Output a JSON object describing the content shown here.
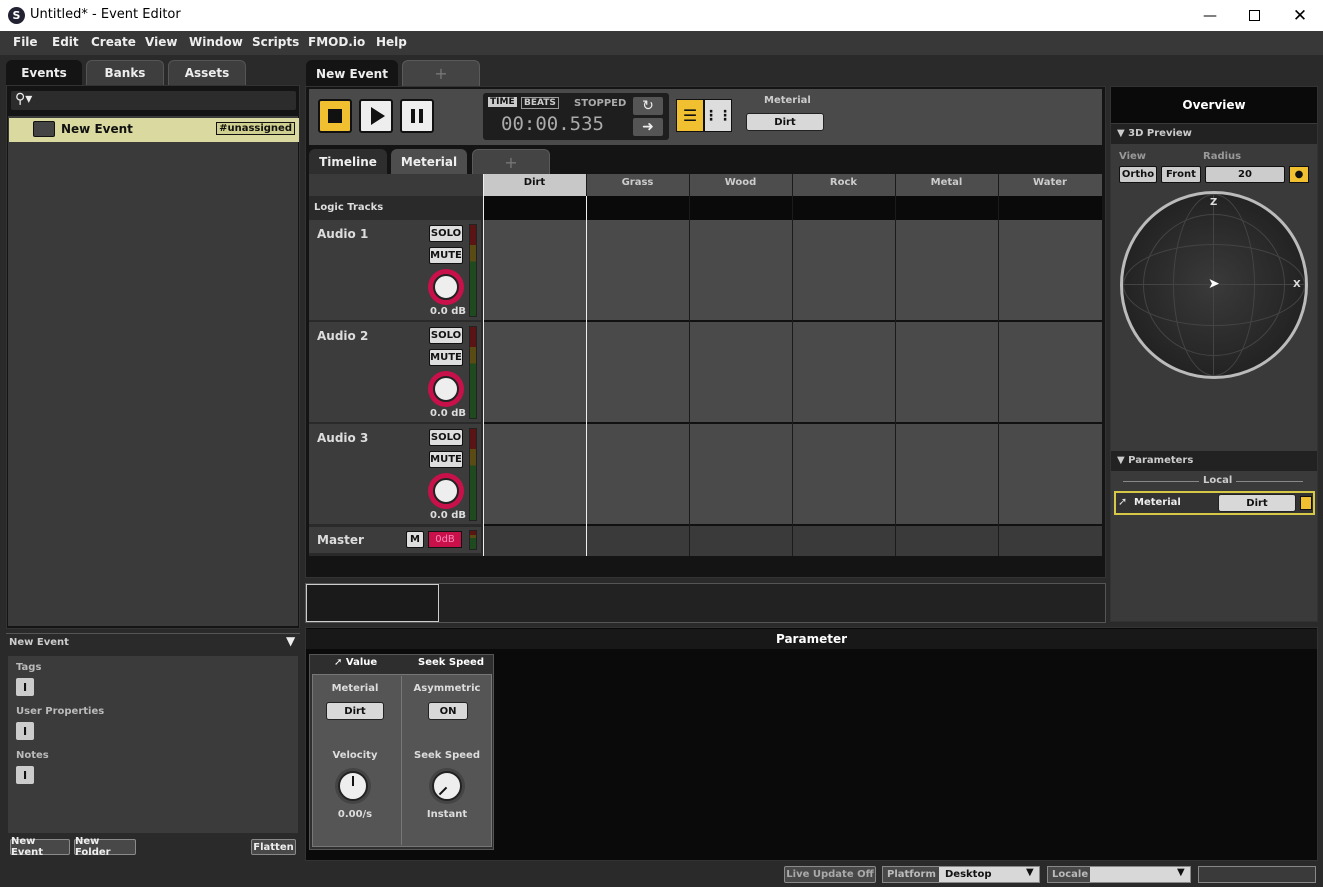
{
  "window": {
    "title": "Untitled* - Event Editor"
  },
  "menu": [
    "File",
    "Edit",
    "Create",
    "View",
    "Window",
    "Scripts",
    "FMOD.io",
    "Help"
  ],
  "browser": {
    "tabs": [
      "Events",
      "Banks",
      "Assets"
    ],
    "item": {
      "label": "New Event",
      "tag": "#unassigned"
    },
    "panel_title": "New Event",
    "sections": [
      "Tags",
      "User Properties",
      "Notes"
    ],
    "buttons": {
      "new_event": "New Event",
      "new_folder": "New Folder",
      "flatten": "Flatten"
    }
  },
  "editor": {
    "event_tab": "New Event",
    "plus": "+",
    "transport": {
      "time": "TIME",
      "beats": "BEATS",
      "status": "STOPPED",
      "clock": "00:00.535"
    },
    "param_label": "Meterial",
    "param_value": "Dirt",
    "subtabs": [
      "Timeline",
      "Meterial"
    ],
    "columns": [
      "Dirt",
      "Grass",
      "Wood",
      "Rock",
      "Metal",
      "Water"
    ],
    "logic_tracks": "Logic Tracks",
    "tracks": [
      {
        "name": "Audio 1",
        "solo": "SOLO",
        "mute": "MUTE",
        "vol": "0.0 dB"
      },
      {
        "name": "Audio 2",
        "solo": "SOLO",
        "mute": "MUTE",
        "vol": "0.0 dB"
      },
      {
        "name": "Audio 3",
        "solo": "SOLO",
        "mute": "MUTE",
        "vol": "0.0 dB"
      }
    ],
    "master": {
      "name": "Master",
      "m": "M",
      "fader": "0dB"
    }
  },
  "overview": {
    "title": "Overview",
    "preview": "3D Preview",
    "view_label": "View",
    "radius_label": "Radius",
    "ortho": "Ortho",
    "front": "Front",
    "radius": "20",
    "axis_z": "Z",
    "axis_x": "X",
    "parameters": "Parameters",
    "local": "Local",
    "param_name": "Meterial",
    "param_value": "Dirt"
  },
  "parameter_panel": {
    "title": "Parameter",
    "tabs": [
      "Value",
      "Seek Speed"
    ],
    "material_label": "Meterial",
    "material_value": "Dirt",
    "asym_label": "Asymmetric",
    "asym_value": "ON",
    "velocity_label": "Velocity",
    "velocity_value": "0.00/s",
    "seek_label": "Seek Speed",
    "seek_value": "Instant"
  },
  "statusbar": {
    "live": "Live Update Off",
    "platform_label": "Platform",
    "platform_value": "Desktop",
    "locale_label": "Locale"
  },
  "colors": {
    "accent": "#f0c030",
    "selection": "#d9d9a0",
    "knob_ring": "#c8104a"
  }
}
